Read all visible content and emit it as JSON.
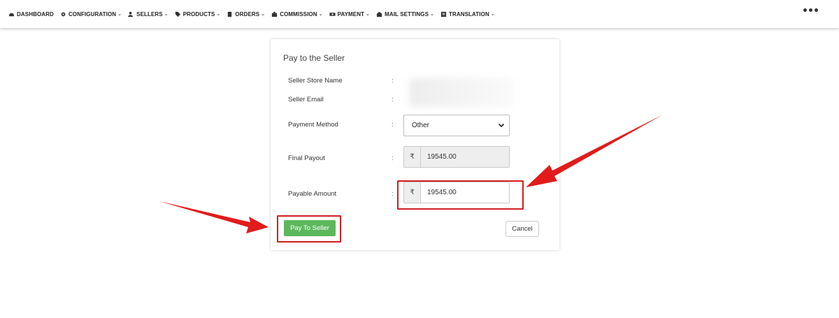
{
  "nav": {
    "items": [
      {
        "label": "DASHBOARD",
        "icon": "dashboard-icon",
        "dropdown": false
      },
      {
        "label": "CONFIGURATION",
        "icon": "gear-icon",
        "dropdown": true
      },
      {
        "label": "SELLERS",
        "icon": "users-icon",
        "dropdown": true
      },
      {
        "label": "PRODUCTS",
        "icon": "tag-icon",
        "dropdown": true
      },
      {
        "label": "ORDERS",
        "icon": "clipboard-icon",
        "dropdown": true
      },
      {
        "label": "COMMISSION",
        "icon": "briefcase-icon",
        "dropdown": true
      },
      {
        "label": "PAYMENT",
        "icon": "money-icon",
        "dropdown": true
      },
      {
        "label": "MAIL SETTINGS",
        "icon": "envelope-icon",
        "dropdown": true
      },
      {
        "label": "TRANSLATION",
        "icon": "translate-icon",
        "dropdown": true
      }
    ],
    "chevron": "⌄"
  },
  "form": {
    "title": "Pay to the Seller",
    "colon": ":",
    "seller_store_name_label": "Seller Store Name",
    "seller_email_label": "Seller Email",
    "payment_method_label": "Payment Method",
    "payment_method_value": "Other",
    "final_payout_label": "Final Payout",
    "final_payout_currency": "₹",
    "final_payout_value": "19545.00",
    "payable_amount_label": "Payable Amount",
    "payable_amount_currency": "₹",
    "payable_amount_value": "19545.00",
    "pay_button_label": "Pay To Seller",
    "cancel_button_label": "Cancel"
  },
  "colors": {
    "primary_green": "#5cb85c",
    "highlight_red": "#d01f1f"
  }
}
